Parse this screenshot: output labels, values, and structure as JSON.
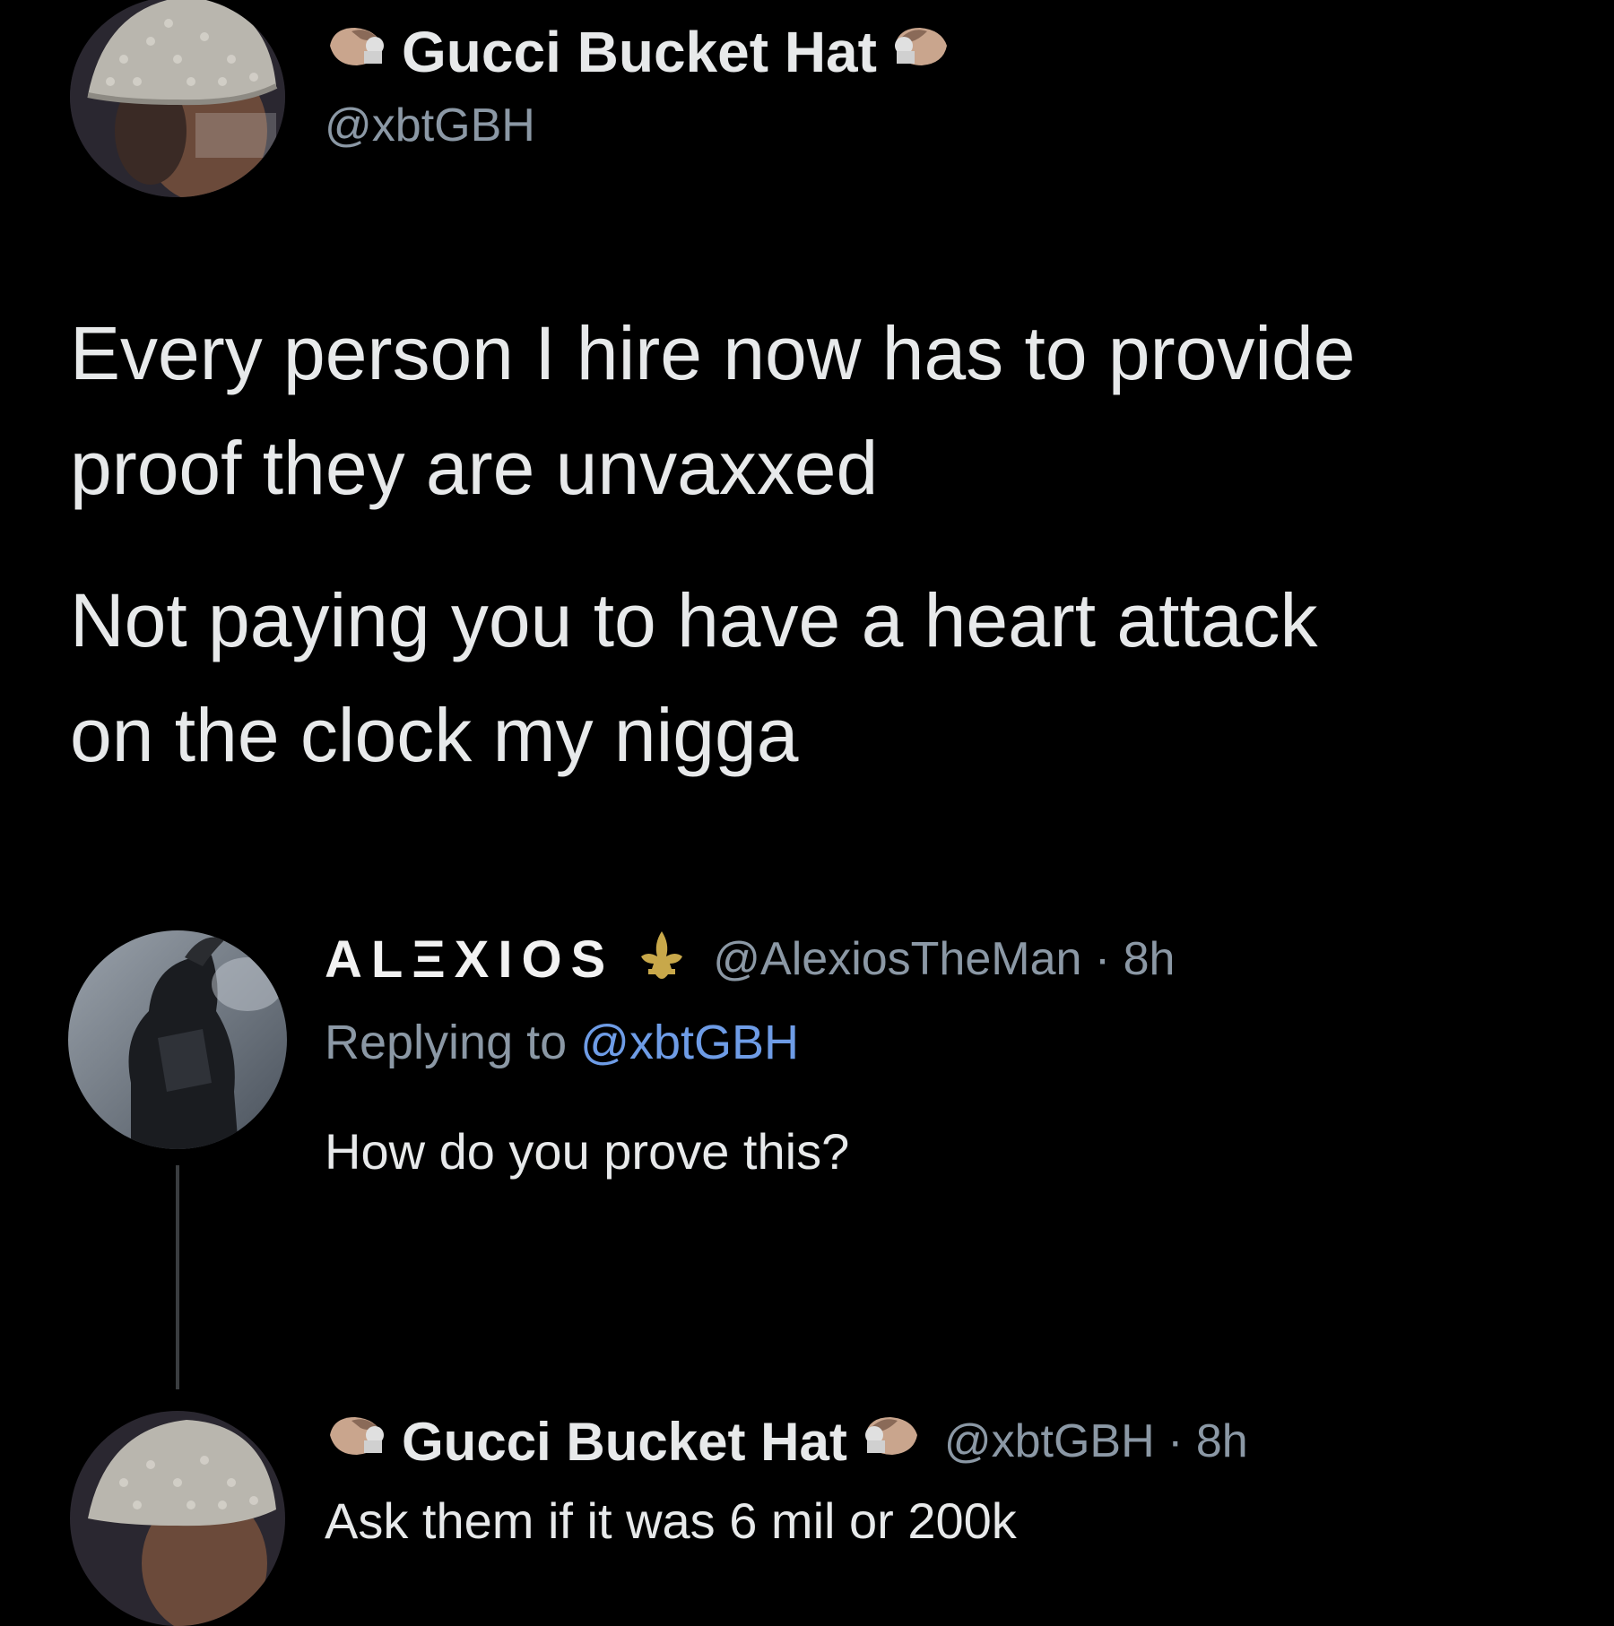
{
  "main_tweet": {
    "display_name": "Gucci Bucket Hat",
    "handle": "@xbtGBH",
    "name_emoji": "pinched-hand-emoji",
    "body_paragraph_1_line_1": "Every person I hire now has to provide",
    "body_paragraph_1_line_2": "proof they are unvaxxed",
    "body_paragraph_2_line_1": "Not paying you to have a heart attack",
    "body_paragraph_2_line_2": "on the clock my nigga"
  },
  "reply_1": {
    "display_name": "ALΞXIOS",
    "name_icon": "fleur-de-lis-icon",
    "handle_time": "@AlexiosTheMan · 8h",
    "replying_prefix": "Replying to ",
    "replying_handle": "@xbtGBH",
    "text": "How do you prove this?"
  },
  "reply_2": {
    "display_name": "Gucci Bucket Hat",
    "handle_time": "@xbtGBH · 8h",
    "text": "Ask them if it was 6 mil or 200k"
  },
  "colors": {
    "background": "#000000",
    "primary_text": "#e7e9ea",
    "secondary_text": "#8b98a5",
    "link": "#6e9ce6"
  }
}
